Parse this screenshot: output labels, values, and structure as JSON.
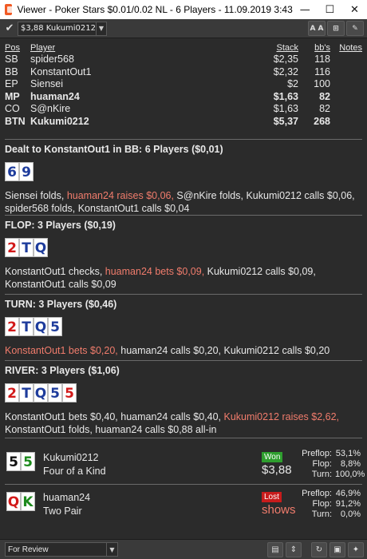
{
  "window": {
    "title": "Viewer - Poker Stars $0.01/0.02 NL - 6 Players - 11.09.2019 3:43",
    "minimize": "—",
    "maximize": "☐",
    "close": "✕"
  },
  "toolbar": {
    "player_select": "$3,88 Kukumi0212",
    "btn_font": "A A",
    "btn_grid": "⊞",
    "btn_edit": "✎"
  },
  "players_table": {
    "headers": {
      "pos": "Pos",
      "player": "Player",
      "stack": "Stack",
      "bbs": "bb's",
      "notes": "Notes"
    },
    "rows": [
      {
        "pos": "SB",
        "player": "spider568",
        "stack": "$2,35",
        "bbs": "118",
        "bold": false
      },
      {
        "pos": "BB",
        "player": "KonstantOut1",
        "stack": "$2,32",
        "bbs": "116",
        "bold": false
      },
      {
        "pos": "EP",
        "player": "Siensei",
        "stack": "$2",
        "bbs": "100",
        "bold": false
      },
      {
        "pos": "MP",
        "player": "huaman24",
        "stack": "$1,63",
        "bbs": "82",
        "bold": true
      },
      {
        "pos": "CO",
        "player": "S@nKire",
        "stack": "$1,63",
        "bbs": "82",
        "bold": false
      },
      {
        "pos": "BTN",
        "player": "Kukumi0212",
        "stack": "$5,37",
        "bbs": "268",
        "bold": true
      }
    ]
  },
  "preflop": {
    "title": "Dealt to KonstantOut1 in BB: 6 Players ($0,01)",
    "cards": [
      {
        "rank": "6",
        "suit": "diamond"
      },
      {
        "rank": "9",
        "suit": "diamond"
      }
    ],
    "actions": [
      {
        "text": "Siensei folds, ",
        "hi": false
      },
      {
        "text": "huaman24 raises $0,06, ",
        "hi": true
      },
      {
        "text": "S@nKire folds, Kukumi0212 calls $0,06, spider568 folds, KonstantOut1 calls $0,04",
        "hi": false
      }
    ]
  },
  "flop": {
    "title": "FLOP: 3 Players ($0,19)",
    "cards": [
      {
        "rank": "2",
        "suit": "heart"
      },
      {
        "rank": "T",
        "suit": "diamond"
      },
      {
        "rank": "Q",
        "suit": "diamond"
      }
    ],
    "actions": [
      {
        "text": "KonstantOut1 checks, ",
        "hi": false
      },
      {
        "text": "huaman24 bets $0,09, ",
        "hi": true
      },
      {
        "text": "Kukumi0212 calls $0,09, KonstantOut1 calls $0,09",
        "hi": false
      }
    ]
  },
  "turn": {
    "title": "TURN: 3 Players ($0,46)",
    "cards": [
      {
        "rank": "2",
        "suit": "heart"
      },
      {
        "rank": "T",
        "suit": "diamond"
      },
      {
        "rank": "Q",
        "suit": "diamond"
      },
      {
        "rank": "5",
        "suit": "diamond"
      }
    ],
    "actions": [
      {
        "text": "KonstantOut1 bets $0,20, ",
        "hi": true
      },
      {
        "text": "huaman24 calls $0,20, Kukumi0212 calls $0,20",
        "hi": false
      }
    ]
  },
  "river": {
    "title": "RIVER: 3 Players ($1,06)",
    "cards": [
      {
        "rank": "2",
        "suit": "heart"
      },
      {
        "rank": "T",
        "suit": "diamond"
      },
      {
        "rank": "Q",
        "suit": "diamond"
      },
      {
        "rank": "5",
        "suit": "diamond"
      },
      {
        "rank": "5",
        "suit": "heart"
      }
    ],
    "actions": [
      {
        "text": "KonstantOut1 bets $0,40, huaman24 calls $0,40, ",
        "hi": false
      },
      {
        "text": "Kukumi0212 raises $2,62, ",
        "hi": true
      },
      {
        "text": "KonstantOut1 folds, huaman24 calls $0,88 all-in",
        "hi": false
      }
    ]
  },
  "results": [
    {
      "name": "Kukumi0212",
      "hand": "Four of a Kind",
      "cards": [
        {
          "rank": "5",
          "suit": "spade"
        },
        {
          "rank": "5",
          "suit": "club"
        }
      ],
      "badge": "Won",
      "badge_type": "won",
      "amount": "$3,88",
      "stats": {
        "preflop_label": "Preflop:",
        "preflop": "53,1%",
        "flop_label": "Flop:",
        "flop": "8,8%",
        "turn_label": "Turn:",
        "turn": "100,0%"
      }
    },
    {
      "name": "huaman24",
      "hand": "Two Pair",
      "cards": [
        {
          "rank": "Q",
          "suit": "heart"
        },
        {
          "rank": "K",
          "suit": "club"
        }
      ],
      "badge": "Lost",
      "badge_type": "lost",
      "amount": "shows",
      "stats": {
        "preflop_label": "Preflop:",
        "preflop": "46,9%",
        "flop_label": "Flop:",
        "flop": "91,2%",
        "turn_label": "Turn:",
        "turn": "0,0%"
      }
    }
  ],
  "bottombar": {
    "review_select": "For Review",
    "btn_clipboard": "▤",
    "btn_updown": "⇕",
    "btn_refresh": "↻",
    "btn_save": "▣",
    "btn_twitter": "✦"
  },
  "colors": {
    "background": "#2b2b2b",
    "highlight_action": "#f07c6c",
    "won": "#2e9e2e",
    "lost": "#c81c1c",
    "diamond": "#1e3c9c",
    "heart": "#d21a1a",
    "club": "#1d8a1d",
    "spade": "#111111"
  }
}
